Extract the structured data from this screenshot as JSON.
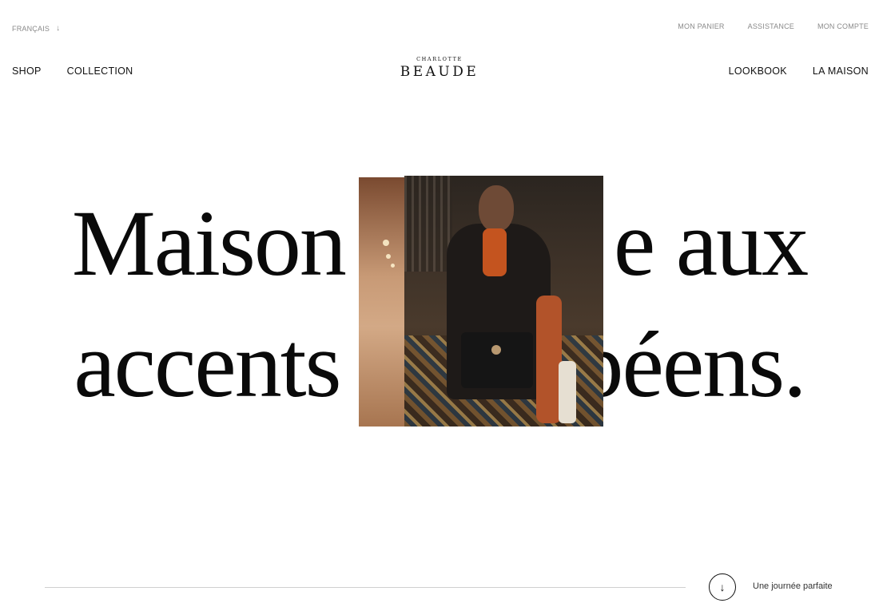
{
  "topbar": {
    "language": "FRANÇAIS",
    "language_arrow": "↓",
    "links": [
      "MON PANIER",
      "ASSISTANCE",
      "MON COMPTE"
    ]
  },
  "nav": {
    "left": [
      "SHOP",
      "COLLECTION"
    ],
    "right": [
      "LOOKBOOK",
      "LA MAISON"
    ]
  },
  "logo": {
    "small": "CHARLOTTE",
    "big": "BEAUDE"
  },
  "hero": {
    "line1_left": "Maison",
    "line1_right": "e aux",
    "line2_left": "accents",
    "line2_right": "péens."
  },
  "footer": {
    "scroll_icon": "↓",
    "scroll_label": "Une journée parfaite"
  },
  "icons": {
    "language_toggle": "arrow-down-icon",
    "scroll_button": "arrow-down-icon"
  }
}
